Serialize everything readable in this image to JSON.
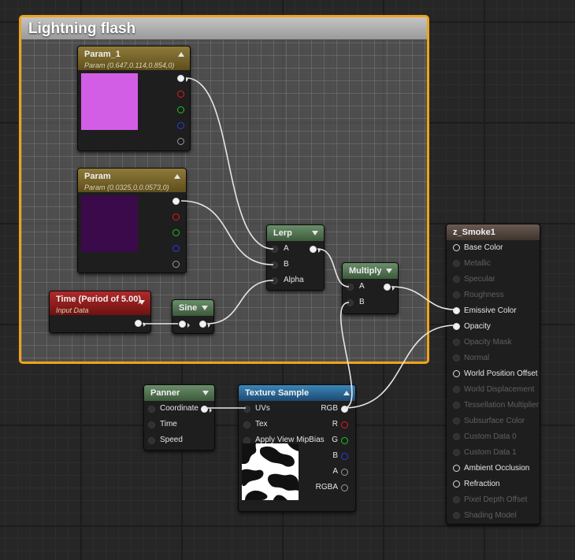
{
  "comment": {
    "title": "Lightning flash",
    "border_color": "#f0a21c"
  },
  "nodes": {
    "param1": {
      "title": "Param_1",
      "subtitle": "Param (0.647,0.114,0.854,0)",
      "swatch_color": "#d35ee6"
    },
    "param": {
      "title": "Param",
      "subtitle": "Param (0.0325,0,0.0573,0)",
      "swatch_color": "#3a0a4a"
    },
    "time": {
      "title": "Time (Period of 5.00)",
      "subtitle": "Input Data"
    },
    "sine": {
      "title": "Sine"
    },
    "lerp": {
      "title": "Lerp",
      "inputs": [
        "A",
        "B",
        "Alpha"
      ]
    },
    "multiply": {
      "title": "Multiply",
      "inputs": [
        "A",
        "B"
      ]
    },
    "panner": {
      "title": "Panner",
      "inputs": [
        "Coordinate",
        "Time",
        "Speed"
      ]
    },
    "texture_sample": {
      "title": "Texture Sample",
      "inputs": [
        "UVs",
        "Tex",
        "Apply View MipBias"
      ],
      "outputs": [
        "RGB",
        "R",
        "G",
        "B",
        "A",
        "RGBA"
      ]
    },
    "material": {
      "title": "z_Smoke1",
      "inputs": [
        {
          "label": "Base Color",
          "enabled": true
        },
        {
          "label": "Metallic",
          "enabled": false
        },
        {
          "label": "Specular",
          "enabled": false
        },
        {
          "label": "Roughness",
          "enabled": false
        },
        {
          "label": "Emissive Color",
          "enabled": true
        },
        {
          "label": "Opacity",
          "enabled": true
        },
        {
          "label": "Opacity Mask",
          "enabled": false
        },
        {
          "label": "Normal",
          "enabled": false
        },
        {
          "label": "World Position Offset",
          "enabled": true
        },
        {
          "label": "World Displacement",
          "enabled": false
        },
        {
          "label": "Tessellation Multiplier",
          "enabled": false
        },
        {
          "label": "Subsurface Color",
          "enabled": false
        },
        {
          "label": "Custom Data 0",
          "enabled": false
        },
        {
          "label": "Custom Data 1",
          "enabled": false
        },
        {
          "label": "Ambient Occlusion",
          "enabled": true
        },
        {
          "label": "Refraction",
          "enabled": true
        },
        {
          "label": "Pixel Depth Offset",
          "enabled": false
        },
        {
          "label": "Shading Model",
          "enabled": false
        }
      ]
    }
  }
}
